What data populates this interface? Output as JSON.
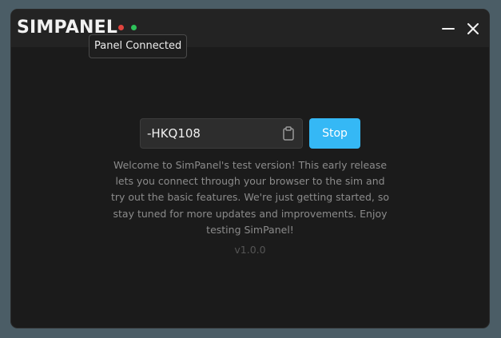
{
  "app": {
    "title": "SIMPANEL",
    "status_tooltip": "Panel Connected"
  },
  "window_controls": {
    "minimize_icon": "minus-icon",
    "close_icon": "close-icon"
  },
  "connection": {
    "code_value": "-HKQ108",
    "copy_icon": "clipboard-icon",
    "stop_label": "Stop"
  },
  "welcome_text": "Welcome to SimPanel's test version! This early release lets you connect through your browser to the sim and try out the basic features. We're just getting started, so stay tuned for more updates and improvements. Enjoy testing SimPanel!",
  "version": "v1.0.0",
  "colors": {
    "accent": "#35b8f5",
    "status_red": "#e0443e",
    "status_green": "#2ec25a",
    "background": "#1b1b1b"
  }
}
